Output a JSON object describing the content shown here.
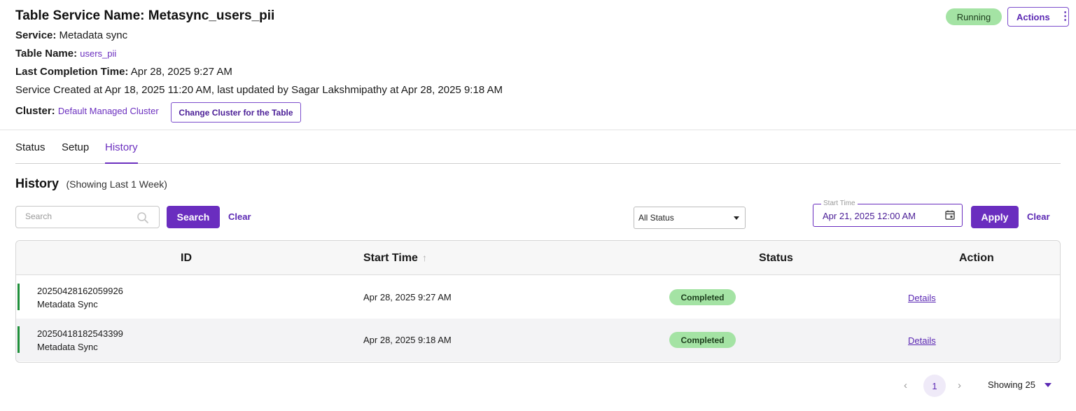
{
  "header": {
    "title": "Table Service Name: Metasync_users_pii",
    "service_label": "Service:",
    "service_value": "Metadata sync",
    "table_name_label": "Table Name:",
    "table_name_value": "users_pii",
    "last_completion_label": "Last Completion Time:",
    "last_completion_value": "Apr 28, 2025 9:27 AM",
    "created_text": "Service Created at Apr 18, 2025 11:20 AM, last updated by Sagar Lakshmipathy at Apr 28, 2025 9:18 AM",
    "cluster_label": "Cluster:",
    "cluster_value": "Default Managed Cluster",
    "change_cluster_label": "Change Cluster for the Table",
    "status_badge": "Running",
    "actions_label": "Actions"
  },
  "tabs": [
    {
      "label": "Status",
      "active": false
    },
    {
      "label": "Setup",
      "active": false
    },
    {
      "label": "History",
      "active": true
    }
  ],
  "history": {
    "title": "History",
    "subtitle": "(Showing Last 1 Week)",
    "search": {
      "placeholder": "Search",
      "value": "",
      "button_label": "Search",
      "clear_label": "Clear"
    },
    "status_filter": {
      "selected": "All Status"
    },
    "start_time": {
      "label": "Start Time",
      "value": "Apr 21, 2025 12:00 AM"
    },
    "apply_label": "Apply",
    "clear_label": "Clear",
    "columns": [
      "ID",
      "Start Time",
      "Status",
      "Action"
    ],
    "rows": [
      {
        "id": "20250428162059926",
        "name": "Metadata Sync",
        "start_time": "Apr 28, 2025 9:27 AM",
        "status": "Completed",
        "action": "Details"
      },
      {
        "id": "20250418182543399",
        "name": "Metadata Sync",
        "start_time": "Apr 28, 2025 9:18 AM",
        "status": "Completed",
        "action": "Details"
      }
    ]
  },
  "pagination": {
    "prev_icon": "chevron-left-icon",
    "next_icon": "chevron-right-icon",
    "current_page": "1",
    "page_size_label": "Showing 25"
  },
  "colors": {
    "accent": "#6a2dbf",
    "success_pill": "#a4e3a4",
    "row_indicator": "#1f8f3a"
  }
}
